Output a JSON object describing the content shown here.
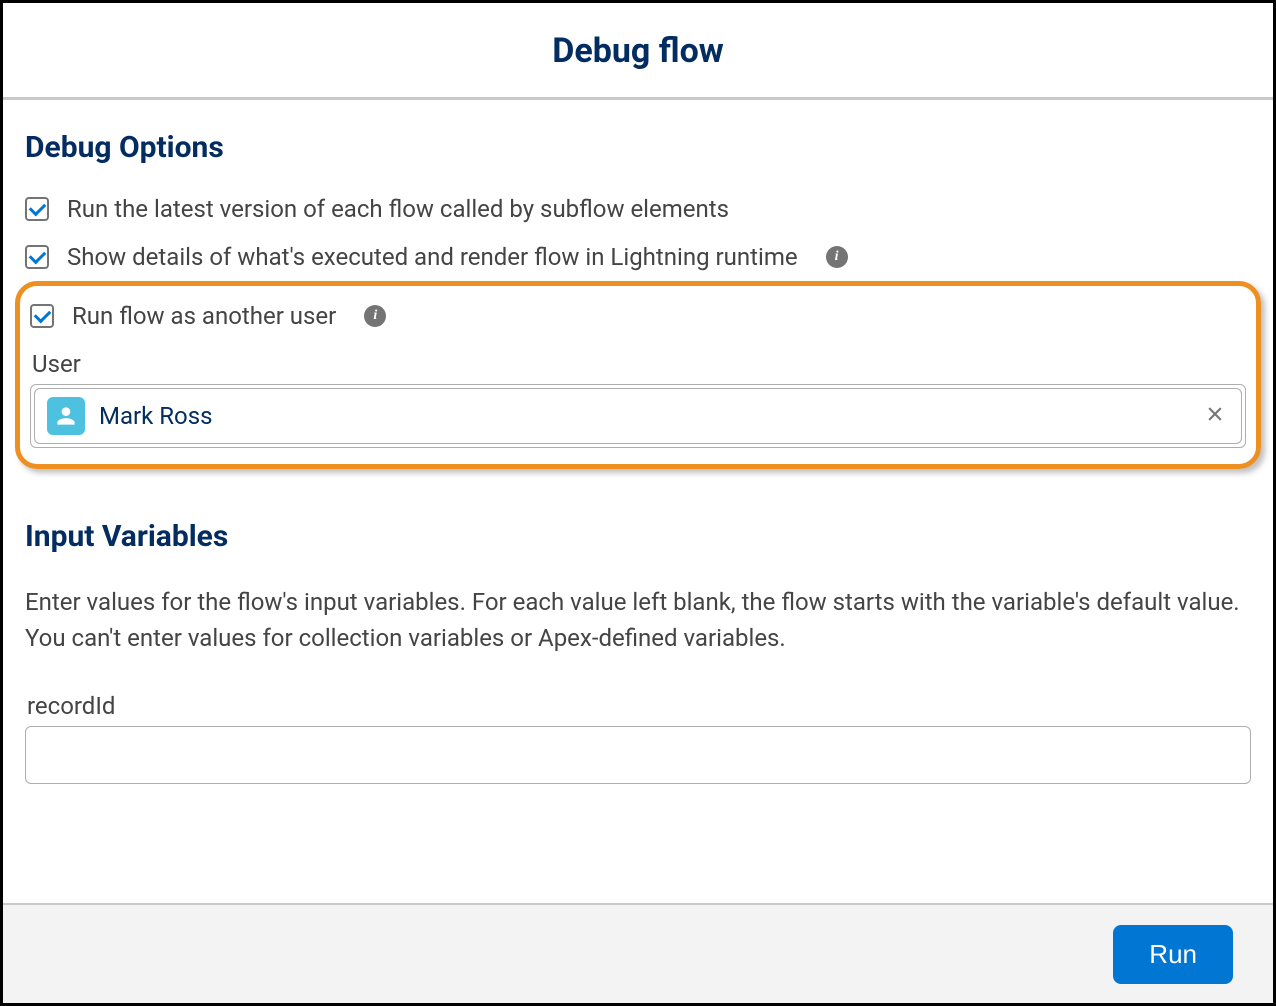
{
  "header": {
    "title": "Debug flow"
  },
  "sections": {
    "debug_options": {
      "title": "Debug Options",
      "options": [
        {
          "label": "Run the latest version of each flow called by subflow elements",
          "checked": true,
          "info": false
        },
        {
          "label": "Show details of what's executed and render flow in Lightning runtime",
          "checked": true,
          "info": true
        },
        {
          "label": "Run flow as another user",
          "checked": true,
          "info": true
        }
      ],
      "user_field": {
        "label": "User",
        "value": "Mark Ross"
      }
    },
    "input_variables": {
      "title": "Input Variables",
      "description": "Enter values for the flow's input variables. For each value left blank, the flow starts with the variable's default value. You can't enter values for collection variables or Apex-defined variables.",
      "fields": [
        {
          "label": "recordId",
          "value": ""
        }
      ]
    }
  },
  "footer": {
    "run_label": "Run"
  }
}
